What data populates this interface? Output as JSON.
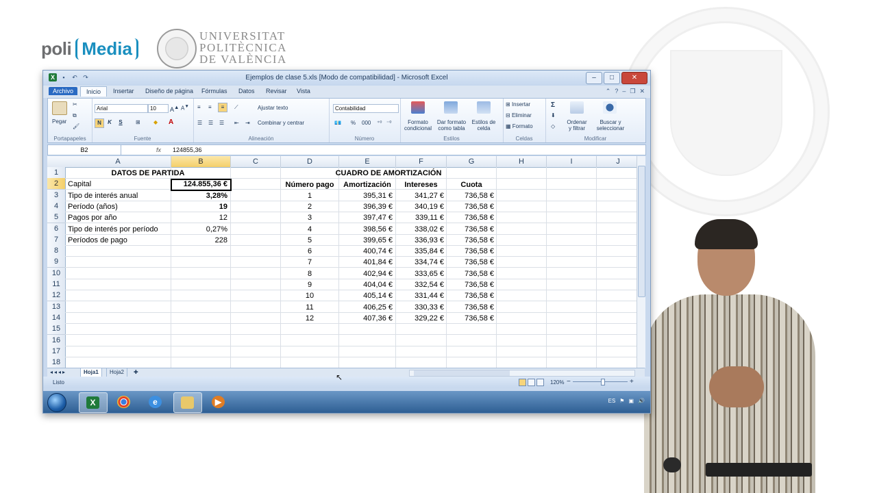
{
  "branding": {
    "poli": "poli",
    "media": "Media",
    "university": [
      "UNIVERSITAT",
      "POLITÈCNICA",
      "DE VALÈNCIA"
    ]
  },
  "window": {
    "title": "Ejemplos de clase 5.xls  [Modo de compatibilidad]  -  Microsoft Excel",
    "controls": [
      "–",
      "□",
      "✕"
    ]
  },
  "ribbon_tabs": [
    "Archivo",
    "Inicio",
    "Insertar",
    "Diseño de página",
    "Fórmulas",
    "Datos",
    "Revisar",
    "Vista"
  ],
  "ribbon": {
    "paste_label": "Pegar",
    "font_name": "Arial",
    "font_size": "10",
    "bold": "N",
    "italic": "K",
    "underline": "S",
    "wrap_text": "Ajustar texto",
    "merge_center": "Combinar y centrar",
    "number_format": "Contabilidad",
    "percent": "%",
    "thousands": "000",
    "cond_format": [
      "Formato",
      "condicional"
    ],
    "format_table": [
      "Dar formato",
      "como tabla"
    ],
    "cell_styles": [
      "Estilos de",
      "celda"
    ],
    "insert": "Insertar",
    "delete": "Eliminar",
    "format": "Formato",
    "sort_filter": [
      "Ordenar",
      "y filtrar"
    ],
    "find_select": [
      "Buscar y",
      "seleccionar"
    ],
    "groups": [
      "Portapapeles",
      "Fuente",
      "Alineación",
      "Número",
      "Estilos",
      "Celdas",
      "Modificar"
    ]
  },
  "formula_bar": {
    "name_box": "B2",
    "fx": "fx",
    "formula": "124855,36"
  },
  "columns": [
    "A",
    "B",
    "C",
    "D",
    "E",
    "F",
    "G",
    "H",
    "I",
    "J"
  ],
  "rows": [
    "1",
    "2",
    "3",
    "4",
    "5",
    "6",
    "7",
    "8",
    "9",
    "10",
    "11",
    "12",
    "13",
    "14",
    "15",
    "16",
    "17",
    "18"
  ],
  "datos_partida": {
    "title": "DATOS DE PARTIDA",
    "items": [
      {
        "label": "Capital",
        "value": "124.855,36 €"
      },
      {
        "label": "Tipo de interés anual",
        "value": "3,28%"
      },
      {
        "label": "Período (años)",
        "value": "19"
      },
      {
        "label": "Pagos por año",
        "value": "12"
      },
      {
        "label": "Tipo de interés por período",
        "value": "0,27%"
      },
      {
        "label": "Períodos de pago",
        "value": "228"
      }
    ]
  },
  "amortizacion": {
    "title": "CUADRO DE AMORTIZACIÓN",
    "headers": [
      "Número pago",
      "Amortización",
      "Intereses",
      "Cuota"
    ],
    "rows": [
      [
        "1",
        "395,31 €",
        "341,27 €",
        "736,58 €"
      ],
      [
        "2",
        "396,39 €",
        "340,19 €",
        "736,58 €"
      ],
      [
        "3",
        "397,47 €",
        "339,11 €",
        "736,58 €"
      ],
      [
        "4",
        "398,56 €",
        "338,02 €",
        "736,58 €"
      ],
      [
        "5",
        "399,65 €",
        "336,93 €",
        "736,58 €"
      ],
      [
        "6",
        "400,74 €",
        "335,84 €",
        "736,58 €"
      ],
      [
        "7",
        "401,84 €",
        "334,74 €",
        "736,58 €"
      ],
      [
        "8",
        "402,94 €",
        "333,65 €",
        "736,58 €"
      ],
      [
        "9",
        "404,04 €",
        "332,54 €",
        "736,58 €"
      ],
      [
        "10",
        "405,14 €",
        "331,44 €",
        "736,58 €"
      ],
      [
        "11",
        "406,25 €",
        "330,33 €",
        "736,58 €"
      ],
      [
        "12",
        "407,36 €",
        "329,22 €",
        "736,58 €"
      ]
    ]
  },
  "sheets": [
    "Hoja1",
    "Hoja2"
  ],
  "status": {
    "text": "Listo",
    "zoom": "120%",
    "zoom_minus": "−",
    "zoom_plus": "+"
  },
  "taskbar": {
    "lang": "ES"
  },
  "colors": {
    "excel_green": "#1f7a3a",
    "selection_header": "#f4cf6a",
    "archivo_tab": "#2a6ac2",
    "poli_media_blue": "#1a8fbf"
  }
}
